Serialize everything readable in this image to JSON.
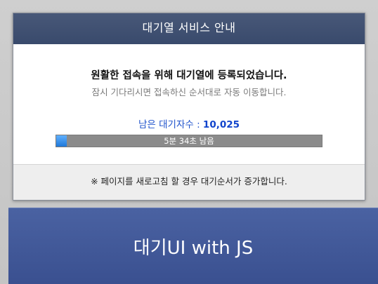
{
  "dialog": {
    "title": "대기열 서비스 안내",
    "message_main": "원활한 접속을 위해 대기열에 등록되었습니다.",
    "message_sub": "잠시 기다리시면 접속하신 순서대로 자동 이동합니다.",
    "queue_label": "남은 대기자수 : ",
    "queue_count": "10,025",
    "progress_text": "5분 34초 남음",
    "progress_fraction": 0.04,
    "footer_note": "※ 페이지를 새로고침 할 경우 대기순서가 증가합니다."
  },
  "banner": {
    "title": "대기UI with JS"
  },
  "colors": {
    "header_bg": "#3d4e70",
    "banner_bg": "#4259a0",
    "progress_track": "#8b8b8b",
    "progress_fill": "#1f78d8",
    "queue_text": "#2255cc"
  }
}
